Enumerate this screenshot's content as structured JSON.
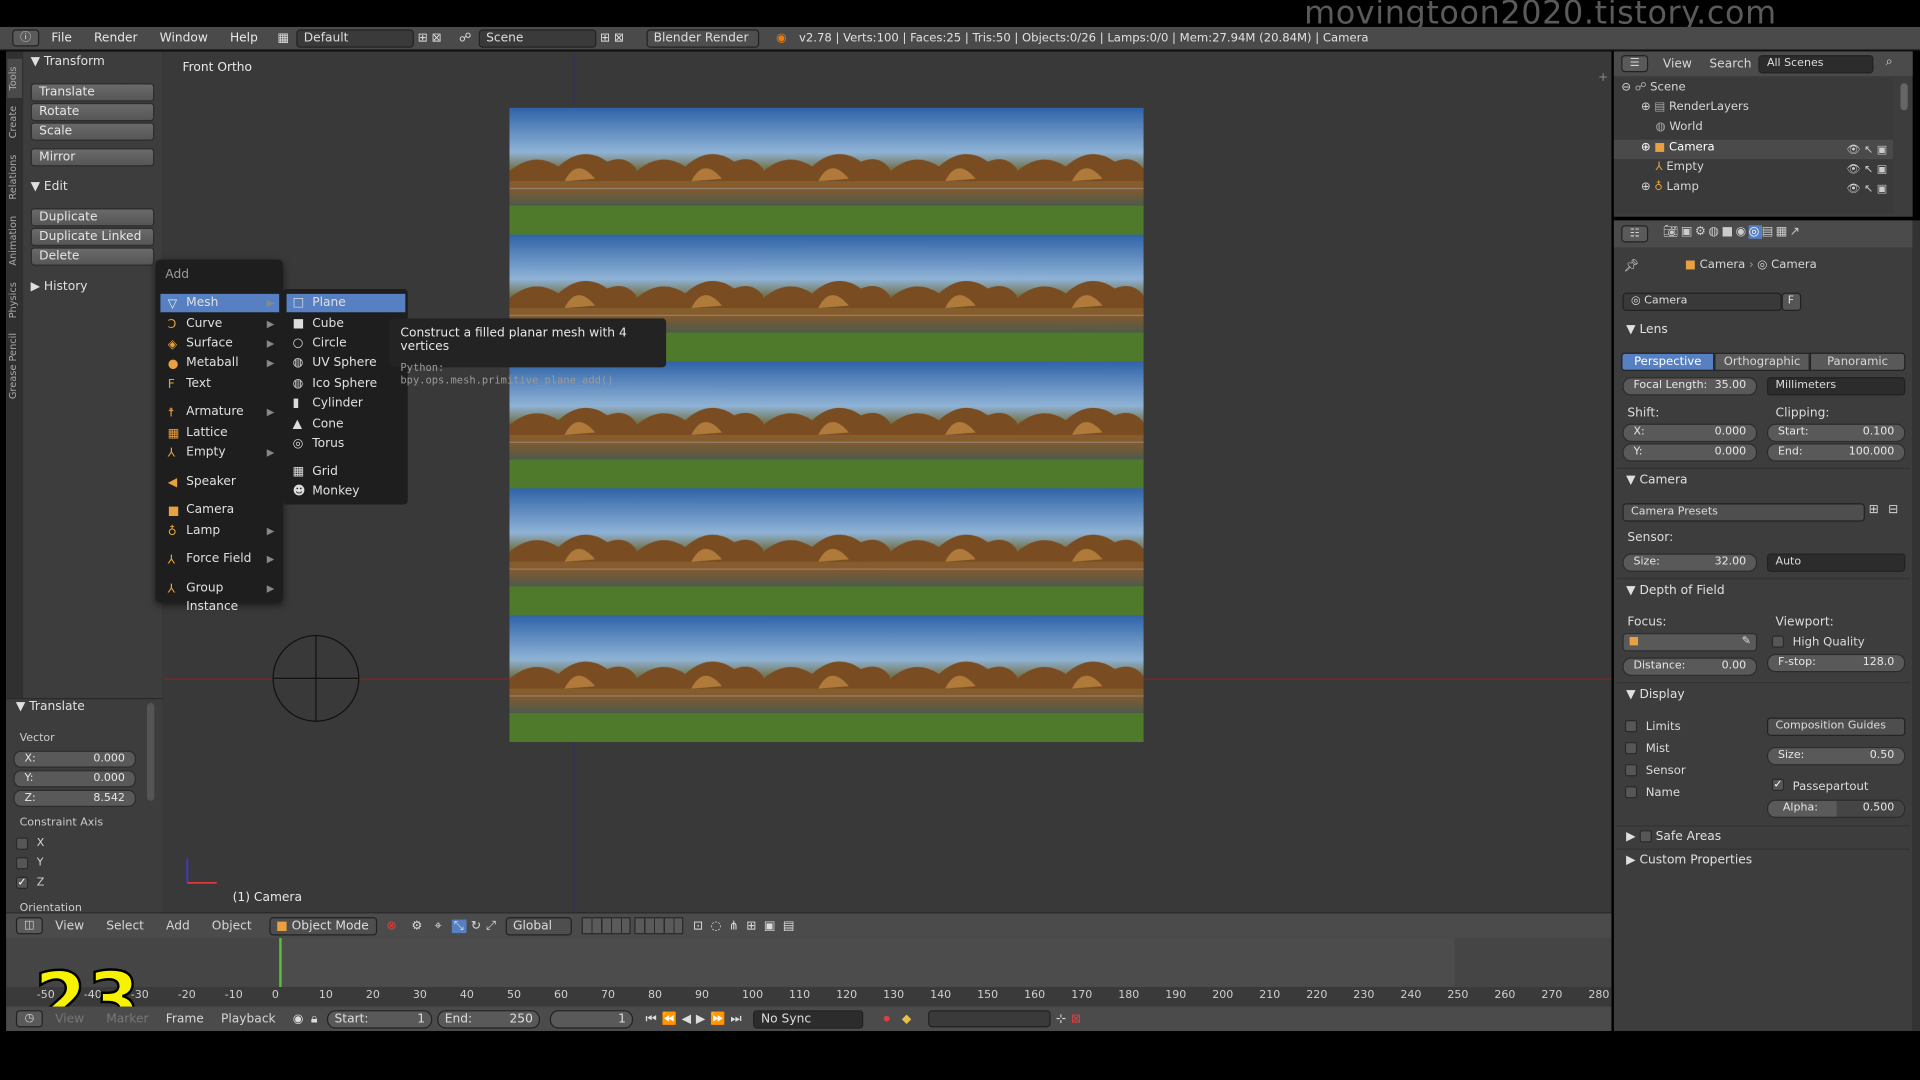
{
  "watermark": "movingtoon2020.tistory.com",
  "episode_number": "23",
  "topbar": {
    "menus": [
      "File",
      "Render",
      "Window",
      "Help"
    ],
    "layout": "Default",
    "scene": "Scene",
    "engine": "Blender Render",
    "stats": "v2.78 | Verts:100 | Faces:25 | Tris:50 | Objects:0/26 | Lamps:0/0 | Mem:27.94M (20.84M) | Camera"
  },
  "toolshelf": {
    "tabs": [
      "Tools",
      "Create",
      "Relations",
      "Animation",
      "Physics",
      "Grease Pencil"
    ],
    "transform_header": "Transform",
    "transform_buttons": [
      "Translate",
      "Rotate",
      "Scale"
    ],
    "mirror_button": "Mirror",
    "edit_header": "Edit",
    "edit_buttons": [
      "Duplicate",
      "Duplicate Linked",
      "Delete"
    ],
    "history_header": "History"
  },
  "operator_panel": {
    "header": "Translate",
    "vector_label": "Vector",
    "x": {
      "label": "X:",
      "value": "0.000"
    },
    "y": {
      "label": "Y:",
      "value": "0.000"
    },
    "z": {
      "label": "Z:",
      "value": "8.542"
    },
    "constraint_label": "Constraint Axis",
    "axes": [
      {
        "label": "X",
        "checked": false
      },
      {
        "label": "Y",
        "checked": false
      },
      {
        "label": "Z",
        "checked": true
      }
    ],
    "orientation_label": "Orientation"
  },
  "viewport": {
    "view_label": "Front Ortho",
    "object_label": "(1) Camera"
  },
  "add_menu": {
    "title": "Add",
    "items": [
      {
        "label": "Mesh",
        "submenu": true,
        "icon": "mesh-icon",
        "glyph": "▽",
        "active": true
      },
      {
        "label": "Curve",
        "submenu": true,
        "icon": "curve-icon",
        "glyph": "Ↄ"
      },
      {
        "label": "Surface",
        "submenu": true,
        "icon": "surface-icon",
        "glyph": "◈"
      },
      {
        "label": "Metaball",
        "submenu": true,
        "icon": "metaball-icon",
        "glyph": "●"
      },
      {
        "label": "Text",
        "submenu": false,
        "icon": "text-icon",
        "glyph": "F"
      },
      {
        "label": "Armature",
        "submenu": true,
        "icon": "armature-icon",
        "glyph": "☨"
      },
      {
        "label": "Lattice",
        "submenu": false,
        "icon": "lattice-icon",
        "glyph": "▦"
      },
      {
        "label": "Empty",
        "submenu": true,
        "icon": "empty-icon",
        "glyph": "⅄"
      },
      {
        "label": "Speaker",
        "submenu": false,
        "icon": "speaker-icon",
        "glyph": "◀"
      },
      {
        "label": "Camera",
        "submenu": false,
        "icon": "camera-icon",
        "glyph": "■"
      },
      {
        "label": "Lamp",
        "submenu": true,
        "icon": "lamp-icon",
        "glyph": "♁"
      },
      {
        "label": "Force Field",
        "submenu": true,
        "icon": "force-field-icon",
        "glyph": "⅄"
      },
      {
        "label": "Group Instance",
        "submenu": true,
        "icon": "group-instance-icon",
        "glyph": "⅄"
      }
    ]
  },
  "mesh_submenu": {
    "items": [
      {
        "label": "Plane",
        "icon": "plane-icon",
        "glyph": "□",
        "active": true
      },
      {
        "label": "Cube",
        "icon": "cube-icon",
        "glyph": "■"
      },
      {
        "label": "Circle",
        "icon": "circle-icon",
        "glyph": "○"
      },
      {
        "label": "UV Sphere",
        "icon": "uv-sphere-icon",
        "glyph": "◍"
      },
      {
        "label": "Ico Sphere",
        "icon": "ico-sphere-icon",
        "glyph": "◍"
      },
      {
        "label": "Cylinder",
        "icon": "cylinder-icon",
        "glyph": "▮"
      },
      {
        "label": "Cone",
        "icon": "cone-icon",
        "glyph": "▲"
      },
      {
        "label": "Torus",
        "icon": "torus-icon",
        "glyph": "◎"
      },
      {
        "label": "Grid",
        "icon": "grid-icon",
        "glyph": "▦"
      },
      {
        "label": "Monkey",
        "icon": "monkey-icon",
        "glyph": "☻"
      }
    ]
  },
  "tooltip": {
    "title": "Construct a filled planar mesh with 4 vertices",
    "python": "Python: bpy.ops.mesh.primitive_plane_add()"
  },
  "view_header": {
    "menus": [
      "View",
      "Select",
      "Add",
      "Object"
    ],
    "mode": "Object Mode",
    "orientation": "Global"
  },
  "timeline": {
    "ticks": [
      "-50",
      "-40",
      "-30",
      "-20",
      "-10",
      "0",
      "10",
      "20",
      "30",
      "40",
      "50",
      "60",
      "70",
      "80",
      "90",
      "100",
      "110",
      "120",
      "130",
      "140",
      "150",
      "160",
      "170",
      "180",
      "190",
      "200",
      "210",
      "220",
      "230",
      "240",
      "250",
      "260",
      "270",
      "280"
    ],
    "current_frame": 0,
    "menus": [
      "View",
      "Marker",
      "Frame",
      "Playback"
    ],
    "start_label": "Start:",
    "start_value": "1",
    "end_label": "End:",
    "end_value": "250",
    "current_value": "1",
    "sync": "No Sync"
  },
  "outliner": {
    "view": "View",
    "search": "Search",
    "filter": "All Scenes",
    "items": [
      {
        "label": "Scene",
        "indent": 0
      },
      {
        "label": "RenderLayers",
        "indent": 1
      },
      {
        "label": "World",
        "indent": 1
      },
      {
        "label": "Camera",
        "indent": 1,
        "selected": true
      },
      {
        "label": "Empty",
        "indent": 1
      },
      {
        "label": "Lamp",
        "indent": 1
      }
    ]
  },
  "properties": {
    "breadcrumb": [
      "Camera",
      "Camera"
    ],
    "datablock": "Camera",
    "datablock_fake": "F",
    "lens_header": "Lens",
    "lens_tabs": [
      "Perspective",
      "Orthographic",
      "Panoramic"
    ],
    "focal_length_label": "Focal Length:",
    "focal_length": "35.00",
    "lens_unit": "Millimeters",
    "shift_label": "Shift:",
    "clipping_label": "Clipping:",
    "shift_x_label": "X:",
    "shift_x": "0.000",
    "shift_y_label": "Y:",
    "shift_y": "0.000",
    "clip_start_label": "Start:",
    "clip_start": "0.100",
    "clip_end_label": "End:",
    "clip_end": "100.000",
    "camera_header": "Camera",
    "camera_presets": "Camera Presets",
    "sensor_label": "Sensor:",
    "sensor_size_label": "Size:",
    "sensor_size": "32.00",
    "sensor_fit": "Auto",
    "dof_header": "Depth of Field",
    "focus_label": "Focus:",
    "viewport_label": "Viewport:",
    "high_quality": "High Quality",
    "distance_label": "Distance:",
    "distance": "0.00",
    "fstop_label": "F-stop:",
    "fstop": "128.0",
    "display_header": "Display",
    "limits": "Limits",
    "mist": "Mist",
    "sensor": "Sensor",
    "name": "Name",
    "composition_guides": "Composition Guides",
    "display_size_label": "Size:",
    "display_size": "0.50",
    "passepartout": "Passepartout",
    "alpha_label": "Alpha:",
    "alpha": "0.500",
    "safe_areas": "Safe Areas",
    "custom_properties": "Custom Properties"
  },
  "colors": {
    "accent_blue": "#5680c2",
    "menu_bg": "#1e1e1e",
    "panel_bg": "#3d3d3d",
    "timeline_cursor": "#58c03a",
    "episode_yellow": "#f6f200"
  }
}
